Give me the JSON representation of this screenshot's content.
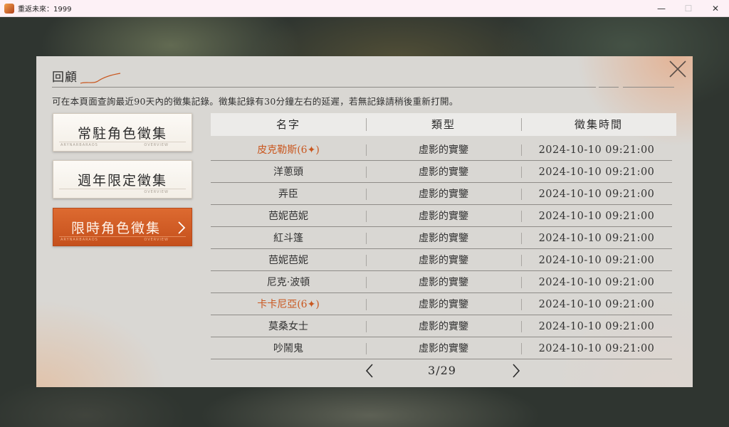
{
  "window": {
    "title": "重返未來：1999",
    "minimize": "—",
    "maximize": "☐",
    "close": "✕"
  },
  "panel": {
    "title": "回顧",
    "description": "可在本頁面查詢最近90天內的徵集記錄。徵集記錄有30分鐘左右的延遲，若無記錄請稍後重新打開。"
  },
  "categories": [
    {
      "label": "常駐角色徵集",
      "active": false
    },
    {
      "label": "週年限定徵集",
      "active": false
    },
    {
      "label": "限時角色徵集",
      "active": true
    }
  ],
  "category_sub": {
    "left": "ARYNARBARAOS",
    "right": "OVERVIEW"
  },
  "table": {
    "headers": [
      "名字",
      "類型",
      "徵集時間"
    ],
    "rows": [
      {
        "name": "皮克勒斯(6✦)",
        "type": "虛影的實鑒",
        "time": "2024-10-10 09:21:00",
        "highlight": true
      },
      {
        "name": "洋蔥頭",
        "type": "虛影的實鑒",
        "time": "2024-10-10 09:21:00",
        "highlight": false
      },
      {
        "name": "弄臣",
        "type": "虛影的實鑒",
        "time": "2024-10-10 09:21:00",
        "highlight": false
      },
      {
        "name": "芭妮芭妮",
        "type": "虛影的實鑒",
        "time": "2024-10-10 09:21:00",
        "highlight": false
      },
      {
        "name": "紅斗篷",
        "type": "虛影的實鑒",
        "time": "2024-10-10 09:21:00",
        "highlight": false
      },
      {
        "name": "芭妮芭妮",
        "type": "虛影的實鑒",
        "time": "2024-10-10 09:21:00",
        "highlight": false
      },
      {
        "name": "尼克·波頓",
        "type": "虛影的實鑒",
        "time": "2024-10-10 09:21:00",
        "highlight": false
      },
      {
        "name": "卡卡尼亞(6✦)",
        "type": "虛影的實鑒",
        "time": "2024-10-10 09:21:00",
        "highlight": true
      },
      {
        "name": "莫桑女士",
        "type": "虛影的實鑒",
        "time": "2024-10-10 09:21:00",
        "highlight": false
      },
      {
        "name": "吵鬧鬼",
        "type": "虛影的實鑒",
        "time": "2024-10-10 09:21:00",
        "highlight": false
      }
    ]
  },
  "pager": {
    "text": "3/29"
  },
  "colors": {
    "accent": "#c9571f",
    "active_button": "#d4602a"
  }
}
